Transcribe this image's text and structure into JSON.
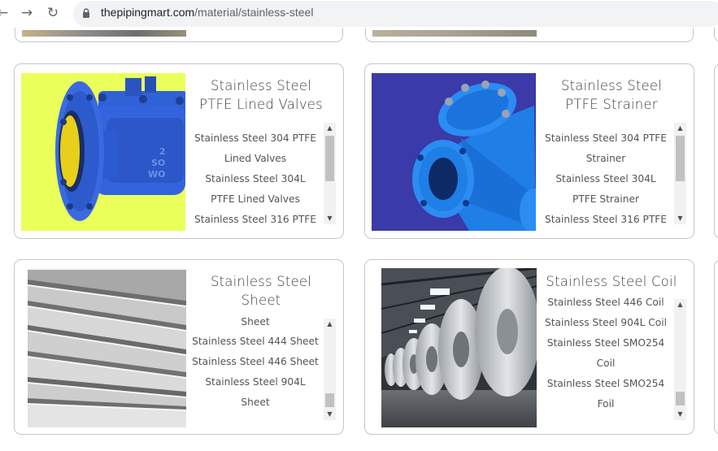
{
  "browser": {
    "url_host": "thepipingmart.com",
    "url_path": "/material/stainless-steel",
    "back_glyph": "←",
    "forward_glyph": "→",
    "reload_glyph": "↻"
  },
  "cards": [
    {
      "title": "Stainless Steel PTFE Lined Valves",
      "image_icon": "ptfe-lined-valve-image",
      "items": [
        "Stainless Steel 304 PTFE Lined Valves",
        "Stainless Steel 304L PTFE Lined Valves",
        "Stainless Steel 316 PTFE"
      ]
    },
    {
      "title": "Stainless Steel PTFE Strainer",
      "image_icon": "y-strainer-image",
      "items": [
        "Stainless Steel 304 PTFE Strainer",
        "Stainless Steel 304L PTFE Strainer",
        "Stainless Steel 316 PTFE"
      ]
    },
    {
      "title": "Stainless Steel Sheet",
      "image_icon": "steel-sheet-stack-image",
      "items": [
        "Sheet",
        "Stainless Steel 444 Sheet",
        "Stainless Steel 446 Sheet",
        "Stainless Steel 904L Sheet"
      ]
    },
    {
      "title": "Stainless Steel Coil",
      "image_icon": "steel-coil-warehouse-image",
      "items": [
        "Stainless Steel 446 Coil",
        "Stainless Steel 904L Coil",
        "Stainless Steel SMO254 Coil",
        "Stainless Steel SMO254 Foil"
      ]
    }
  ],
  "colors": {
    "border": "#c7c7c7",
    "valve_bg": "#eaff5a",
    "strainer_bg": "#3a3aa8",
    "valve_blue": "#2d5fd8"
  }
}
